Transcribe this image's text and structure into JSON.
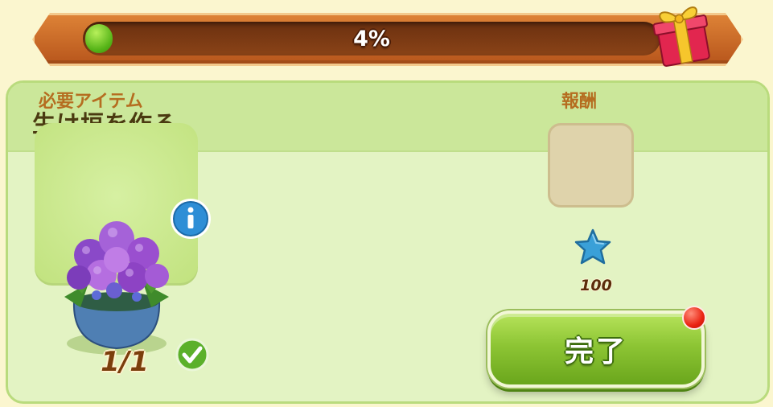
{
  "progress": {
    "label": "4%",
    "fraction": 0.04,
    "reward_icon": "gift-box-icon"
  },
  "task": {
    "title": "生け垣を作る",
    "required_label": "必要アイテム",
    "reward_label": "報酬",
    "item": {
      "icon": "hydrangea-pot-icon",
      "count": "1/1",
      "info_icon": "info-icon",
      "status_icon": "checkmark-icon"
    },
    "reward": {
      "icon": "blue-star-icon",
      "amount": "100"
    },
    "complete_button": {
      "label": "完了",
      "has_notification": true
    }
  },
  "colors": {
    "background": "#fbf6cf",
    "panel": "#e3f3c3",
    "panel_header": "#cbe79a",
    "progress_frame": "#c9672a",
    "progress_fill": "#56b418",
    "button": "#8dc534",
    "section_label": "#b56d20",
    "notification": "#ea2412"
  }
}
